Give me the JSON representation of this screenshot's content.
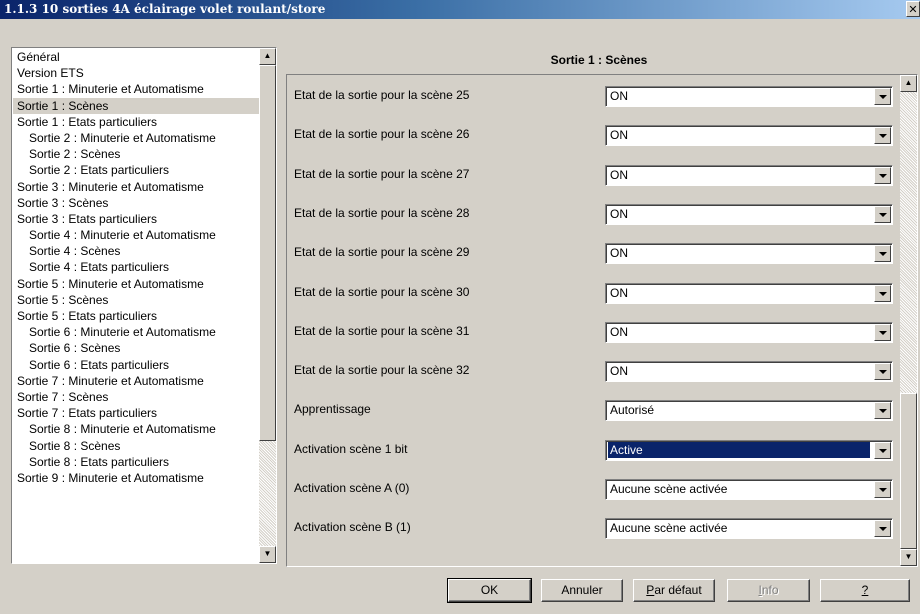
{
  "window": {
    "title": "1.1.3 10 sorties 4A éclairage volet roulant/store",
    "close_glyph": "✕"
  },
  "tree": {
    "selected_index": 3,
    "items": [
      {
        "label": "Général",
        "level": 1
      },
      {
        "label": "Version ETS",
        "level": 1
      },
      {
        "label": "Sortie 1 : Minuterie et Automatisme",
        "level": 1
      },
      {
        "label": "Sortie 1 : Scènes",
        "level": 1
      },
      {
        "label": "Sortie 1 : Etats particuliers",
        "level": 1
      },
      {
        "label": "Sortie 2 : Minuterie et Automatisme",
        "level": 2
      },
      {
        "label": "Sortie 2 : Scènes",
        "level": 2
      },
      {
        "label": "Sortie 2 : Etats particuliers",
        "level": 2
      },
      {
        "label": "Sortie 3 : Minuterie et Automatisme",
        "level": 1
      },
      {
        "label": "Sortie 3 : Scènes",
        "level": 1
      },
      {
        "label": "Sortie 3 : Etats particuliers",
        "level": 1
      },
      {
        "label": "Sortie 4 : Minuterie et Automatisme",
        "level": 2
      },
      {
        "label": "Sortie 4 : Scènes",
        "level": 2
      },
      {
        "label": "Sortie 4 : Etats particuliers",
        "level": 2
      },
      {
        "label": "Sortie 5 : Minuterie et Automatisme",
        "level": 1
      },
      {
        "label": "Sortie 5 : Scènes",
        "level": 1
      },
      {
        "label": "Sortie 5 : Etats particuliers",
        "level": 1
      },
      {
        "label": "Sortie 6 : Minuterie et Automatisme",
        "level": 2
      },
      {
        "label": "Sortie 6 : Scènes",
        "level": 2
      },
      {
        "label": "Sortie 6 : Etats particuliers",
        "level": 2
      },
      {
        "label": "Sortie 7 : Minuterie et Automatisme",
        "level": 1
      },
      {
        "label": "Sortie 7 : Scènes",
        "level": 1
      },
      {
        "label": "Sortie 7 : Etats particuliers",
        "level": 1
      },
      {
        "label": "Sortie 8 : Minuterie et Automatisme",
        "level": 2
      },
      {
        "label": "Sortie 8 : Scènes",
        "level": 2
      },
      {
        "label": "Sortie 8 : Etats particuliers",
        "level": 2
      },
      {
        "label": "Sortie 9 : Minuterie et Automatisme",
        "level": 1
      }
    ]
  },
  "panel": {
    "title": "Sortie 1 : Scènes",
    "params": [
      {
        "label": "Etat de la sortie pour la scène 25",
        "value": "ON",
        "selected": false
      },
      {
        "label": "Etat de la sortie pour la scène 26",
        "value": "ON",
        "selected": false
      },
      {
        "label": "Etat de la sortie pour la scène 27",
        "value": "ON",
        "selected": false
      },
      {
        "label": "Etat de la sortie pour la scène 28",
        "value": "ON",
        "selected": false
      },
      {
        "label": "Etat de la sortie pour la scène 29",
        "value": "ON",
        "selected": false
      },
      {
        "label": "Etat de la sortie pour la scène 30",
        "value": "ON",
        "selected": false
      },
      {
        "label": "Etat de la sortie pour la scène 31",
        "value": "ON",
        "selected": false
      },
      {
        "label": "Etat de la sortie pour la scène 32",
        "value": "ON",
        "selected": false
      },
      {
        "label": "Apprentissage",
        "value": "Autorisé",
        "selected": false
      },
      {
        "label": "Activation scène 1 bit",
        "value": "Active",
        "selected": true
      },
      {
        "label": "Activation scène A (0)",
        "value": "Aucune scène activée",
        "selected": false
      },
      {
        "label": "Activation scène B (1)",
        "value": "Aucune scène activée",
        "selected": false
      }
    ]
  },
  "buttons": {
    "ok": "OK",
    "cancel": "Annuler",
    "default_first": "P",
    "default_rest": "ar défaut",
    "info_first": "I",
    "info_rest": "nfo",
    "help": "?"
  },
  "scroll_glyphs": {
    "up": "▲",
    "down": "▼"
  },
  "colors": {
    "selection_bg": "#0a246a",
    "dialog_bg": "#d4d0c8"
  }
}
